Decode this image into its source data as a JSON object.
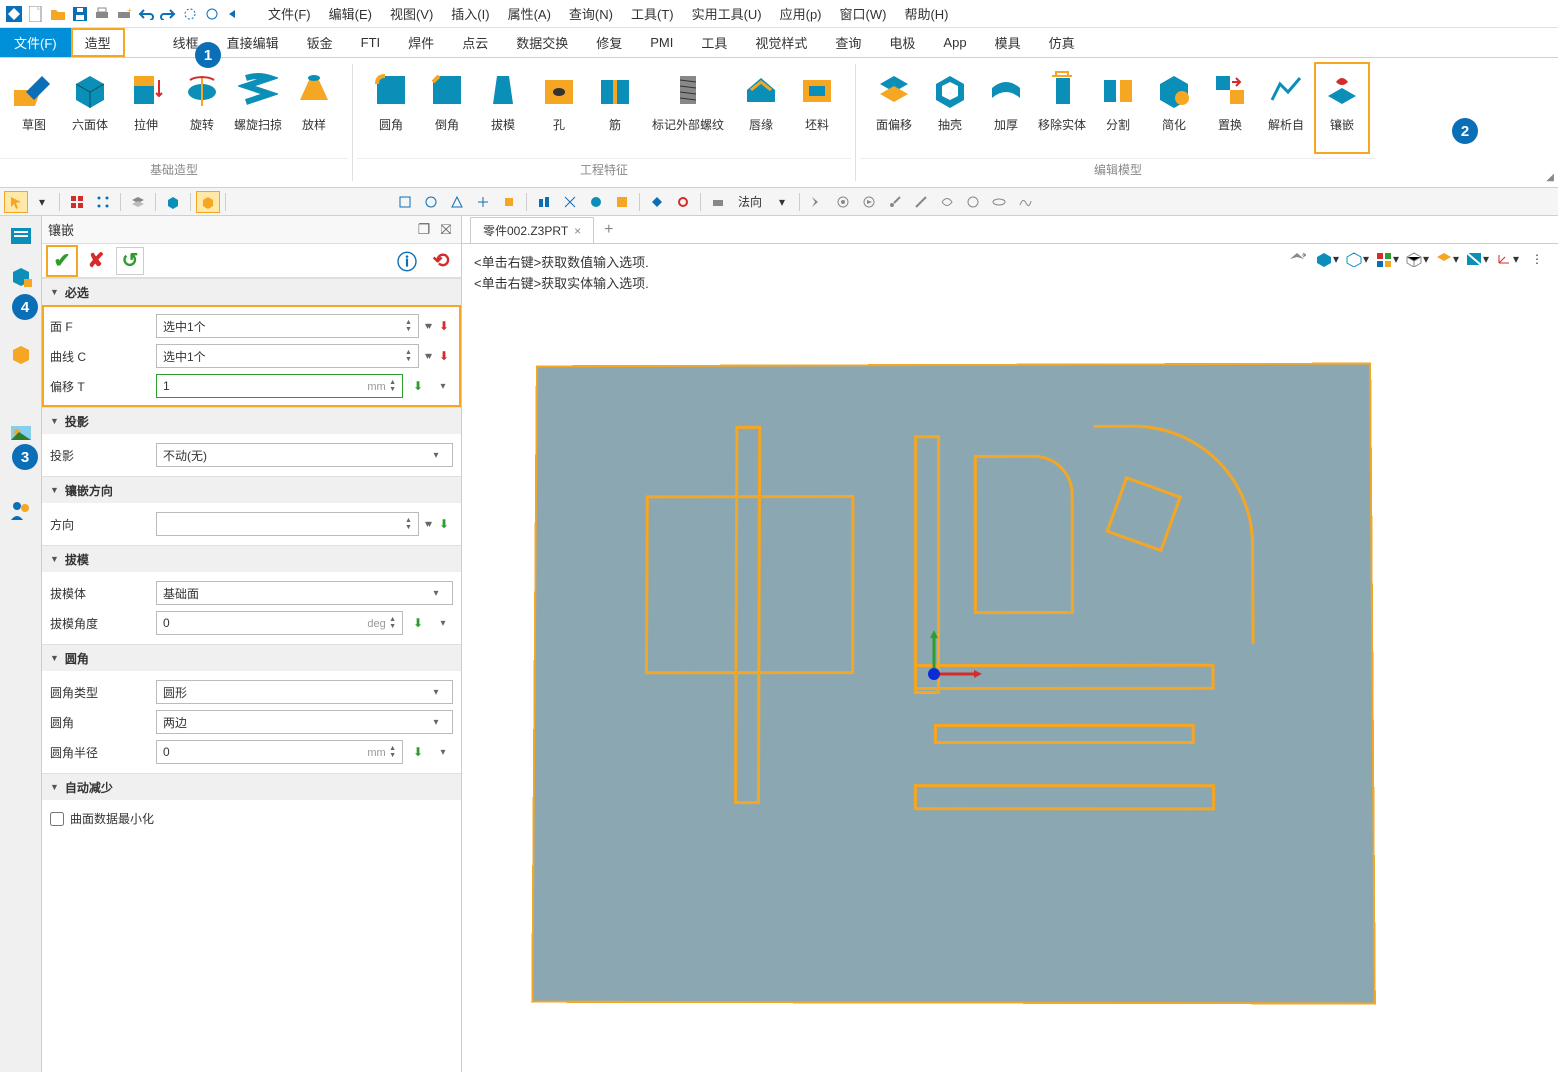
{
  "menubar": {
    "items": [
      "文件(F)",
      "编辑(E)",
      "视图(V)",
      "插入(I)",
      "属性(A)",
      "查询(N)",
      "工具(T)",
      "实用工具(U)",
      "应用(p)",
      "窗口(W)",
      "帮助(H)"
    ]
  },
  "ribbon_tabs": [
    "文件(F)",
    "造型",
    "线框",
    "直接编辑",
    "钣金",
    "FTI",
    "焊件",
    "点云",
    "数据交换",
    "修复",
    "PMI",
    "工具",
    "视觉样式",
    "查询",
    "电极",
    "App",
    "模具",
    "仿真"
  ],
  "ribbon_groups": {
    "basic": {
      "label": "基础造型",
      "btns": [
        "草图",
        "六面体",
        "拉伸",
        "旋转",
        "螺旋扫掠",
        "放样"
      ]
    },
    "eng": {
      "label": "工程特征",
      "btns": [
        "圆角",
        "倒角",
        "拔模",
        "孔",
        "筋",
        "标记外部螺纹",
        "唇缘",
        "坯料"
      ]
    },
    "edit": {
      "label": "编辑模型",
      "btns": [
        "面偏移",
        "抽壳",
        "加厚",
        "移除实体",
        "分割",
        "简化",
        "置换",
        "解析自",
        "镶嵌"
      ]
    }
  },
  "quickbar": {
    "normal_label": "法向"
  },
  "panel": {
    "title": "镶嵌",
    "sections": {
      "required": {
        "title": "必选",
        "rows": [
          {
            "label": "面 F",
            "value": "选中1个"
          },
          {
            "label": "曲线 C",
            "value": "选中1个"
          },
          {
            "label": "偏移 T",
            "value": "1",
            "unit": "mm"
          }
        ]
      },
      "projection": {
        "title": "投影",
        "rows": [
          {
            "label": "投影",
            "value": "不动(无)"
          }
        ]
      },
      "direction": {
        "title": "镶嵌方向",
        "rows": [
          {
            "label": "方向",
            "value": ""
          }
        ]
      },
      "draft": {
        "title": "拔模",
        "rows": [
          {
            "label": "拔模体",
            "value": "基础面"
          },
          {
            "label": "拔模角度",
            "value": "0",
            "unit": "deg"
          }
        ]
      },
      "fillet": {
        "title": "圆角",
        "rows": [
          {
            "label": "圆角类型",
            "value": "圆形"
          },
          {
            "label": "圆角",
            "value": "两边"
          },
          {
            "label": "圆角半径",
            "value": "0",
            "unit": "mm"
          }
        ]
      },
      "auto": {
        "title": "自动减少",
        "check": "曲面数据最小化"
      }
    }
  },
  "viewport": {
    "tab": "零件002.Z3PRT",
    "hints": [
      "<单击右键>获取数值输入选项.",
      "<单击右键>获取实体输入选项."
    ]
  },
  "callouts": [
    "1",
    "2",
    "3",
    "4"
  ]
}
